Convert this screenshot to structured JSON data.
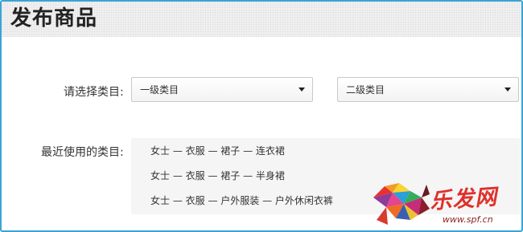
{
  "header": {
    "title": "发布商品"
  },
  "category_select": {
    "label": "请选择类目:",
    "level1_value": "一级类目",
    "level2_value": "二级类目"
  },
  "recent": {
    "label": "最近使用的类目:",
    "items": [
      "女士 — 衣服 — 裙子 — 连衣裙",
      "女士 — 衣服 — 裙子 — 半身裙",
      "女士 — 衣服 — 户外服装 — 户外休闲衣裤"
    ]
  },
  "watermark": {
    "logo_text": "乐发网",
    "url": "www.spf.cn",
    "icon": "bull-logo-icon"
  },
  "colors": {
    "border": "#3aa3d6",
    "logo_red": "#e0302c"
  }
}
